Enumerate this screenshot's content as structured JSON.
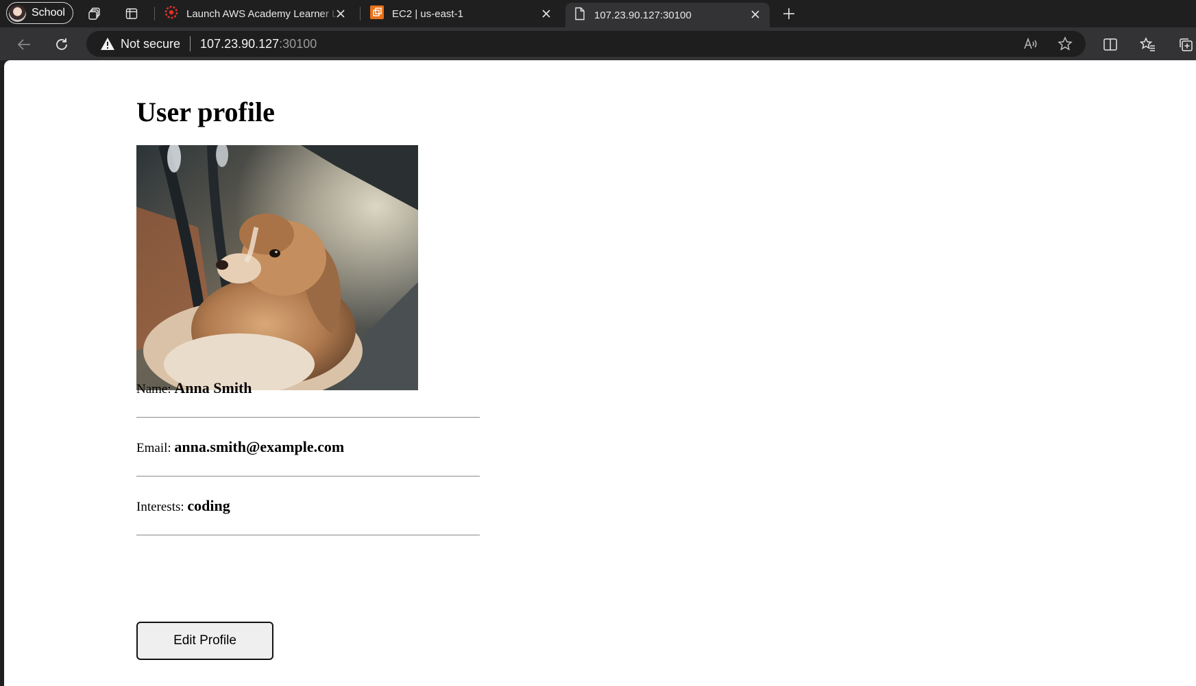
{
  "browser": {
    "profile": {
      "label": "School"
    },
    "tabs": [
      {
        "title": "Launch AWS Academy Learner La",
        "icon": "aws-academy-icon",
        "active": false
      },
      {
        "title": "EC2 | us-east-1",
        "icon": "aws-ec2-icon",
        "active": false
      },
      {
        "title": "107.23.90.127:30100",
        "icon": "document-icon",
        "active": true
      }
    ],
    "address_bar": {
      "security_label": "Not secure",
      "host": "107.23.90.127",
      "port": ":30100"
    },
    "toolbar_icons": [
      "back-icon",
      "refresh-icon",
      "read-aloud-icon",
      "favorite-star-icon",
      "split-screen-icon",
      "favorites-icon",
      "collections-icon"
    ]
  },
  "page": {
    "title": "User profile",
    "photo": {
      "subject": "dog-photo"
    },
    "fields": [
      {
        "label": "Name:",
        "value": "Anna Smith"
      },
      {
        "label": "Email:",
        "value": "anna.smith@example.com"
      },
      {
        "label": "Interests:",
        "value": "coding"
      }
    ],
    "edit_button_label": "Edit Profile"
  },
  "colors": {
    "chrome_dark": "#1f1f1f",
    "toolbar": "#333336",
    "omnibox": "#1e1e1e",
    "page_bg": "#ffffff",
    "button_bg": "#efefef"
  }
}
